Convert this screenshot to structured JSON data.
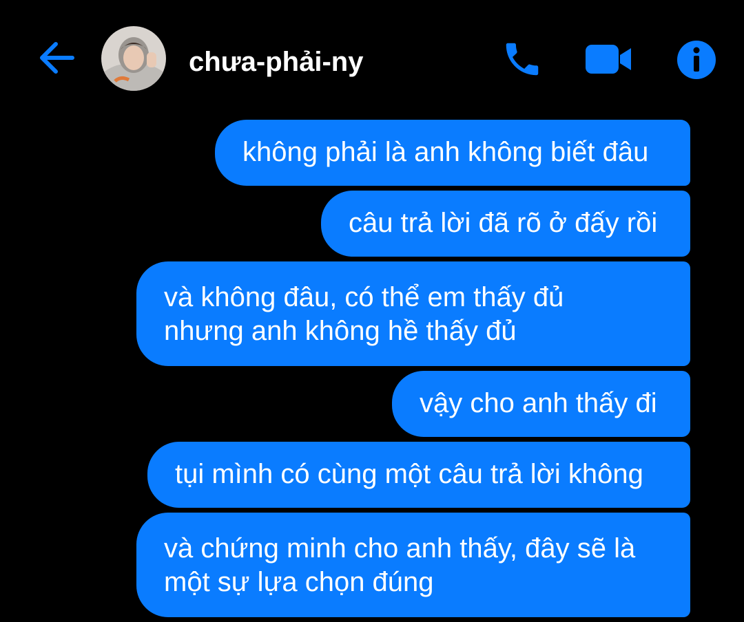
{
  "header": {
    "contact_name": "chưa-phải-ny",
    "back_icon": "arrow-left-icon",
    "call_icon": "phone-icon",
    "video_icon": "video-camera-icon",
    "info_icon": "info-icon",
    "accent_color": "#0a7cff"
  },
  "messages": [
    {
      "text": "không phải là anh không biết đâu"
    },
    {
      "text": "câu trả lời đã rõ ở đấy rồi"
    },
    {
      "text": "và không đâu, có thể em thấy đủ\nnhưng anh không hề thấy đủ"
    },
    {
      "text": "vậy cho anh thấy đi"
    },
    {
      "text": "tụi mình có cùng một câu trả lời không"
    },
    {
      "text": "và chứng minh cho anh thấy, đây sẽ là\nmột sự lựa chọn đúng"
    }
  ]
}
